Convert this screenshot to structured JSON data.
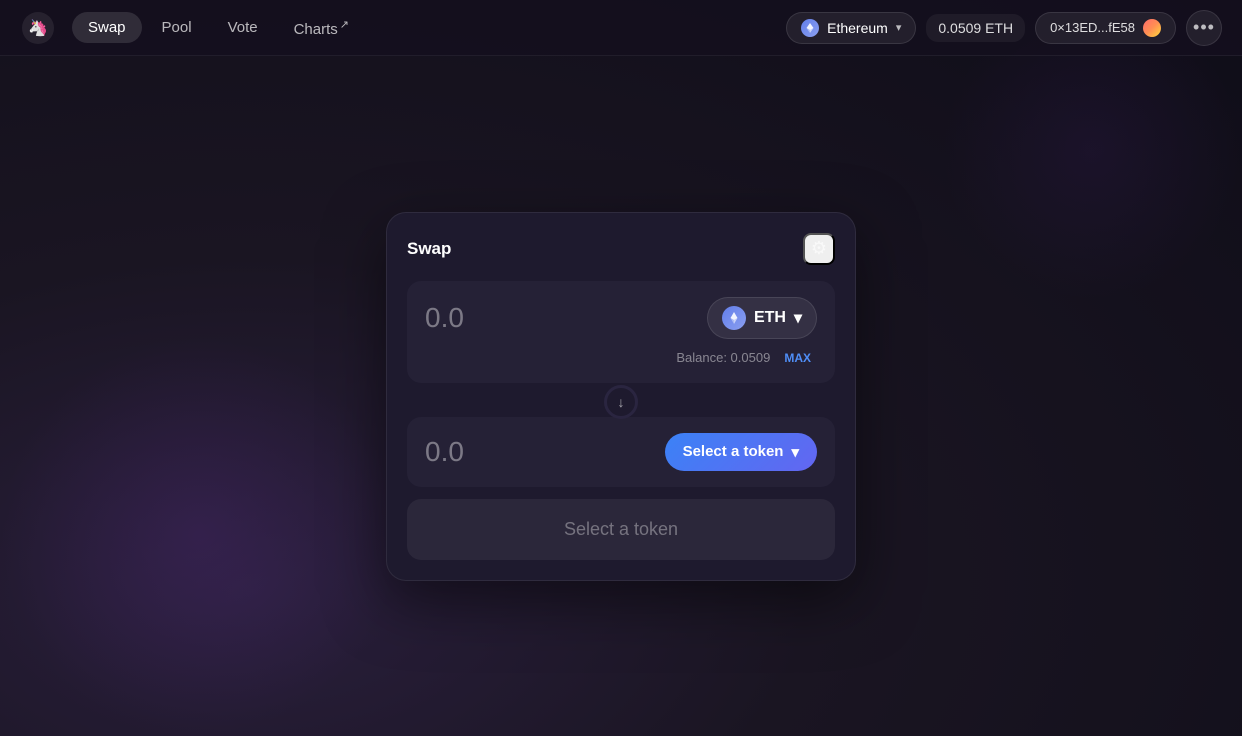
{
  "app": {
    "logo_alt": "Uniswap logo"
  },
  "navbar": {
    "links": [
      {
        "id": "swap",
        "label": "Swap",
        "active": true,
        "external": false
      },
      {
        "id": "pool",
        "label": "Pool",
        "active": false,
        "external": false
      },
      {
        "id": "vote",
        "label": "Vote",
        "active": false,
        "external": false
      },
      {
        "id": "charts",
        "label": "Charts",
        "active": false,
        "external": true
      }
    ],
    "network": {
      "name": "Ethereum",
      "chevron": "▾"
    },
    "balance": "0.0509 ETH",
    "wallet": {
      "address": "0×13ED...fE58"
    },
    "more_label": "•••"
  },
  "swap": {
    "title": "Swap",
    "from": {
      "amount": "0.0",
      "token_symbol": "ETH",
      "balance_label": "Balance: 0.0509",
      "max_label": "MAX"
    },
    "to": {
      "amount": "0.0",
      "select_token_label": "Select a token",
      "chevron": "▾"
    },
    "swap_direction_arrow": "↓",
    "action_button_label": "Select a token"
  }
}
